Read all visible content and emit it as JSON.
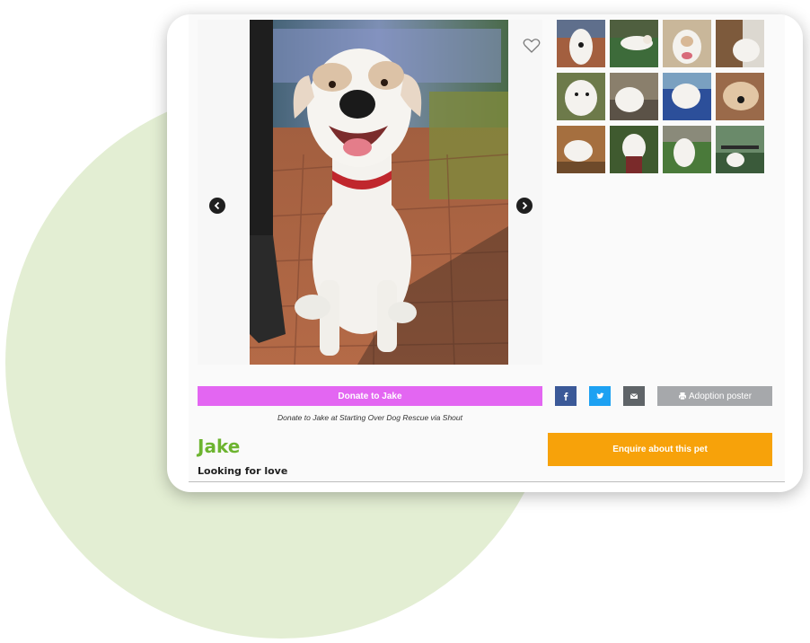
{
  "pet": {
    "name": "Jake",
    "status": "Looking for love"
  },
  "gallery": {
    "main_photo_icon": "dog-photo",
    "prev_icon": "chevron-left-icon",
    "next_icon": "chevron-right-icon",
    "favorite_icon": "heart-outline-icon",
    "thumbnail_count": 12
  },
  "actions": {
    "donate_label": "Donate to Jake",
    "donate_note": "Donate to Jake at Starting Over Dog Rescue via Shout",
    "share_facebook_icon": "facebook-icon",
    "share_twitter_icon": "twitter-icon",
    "share_email_icon": "email-icon",
    "poster_label": "Adoption poster",
    "enquire_label": "Enquire about this pet"
  },
  "colors": {
    "background_circle": "#e3eed3",
    "donate": "#e366f2",
    "facebook": "#3b5998",
    "twitter": "#1da1f2",
    "email": "#5f6468",
    "poster": "#a6a8ab",
    "enquire": "#f7a20a",
    "name": "#6db430"
  }
}
